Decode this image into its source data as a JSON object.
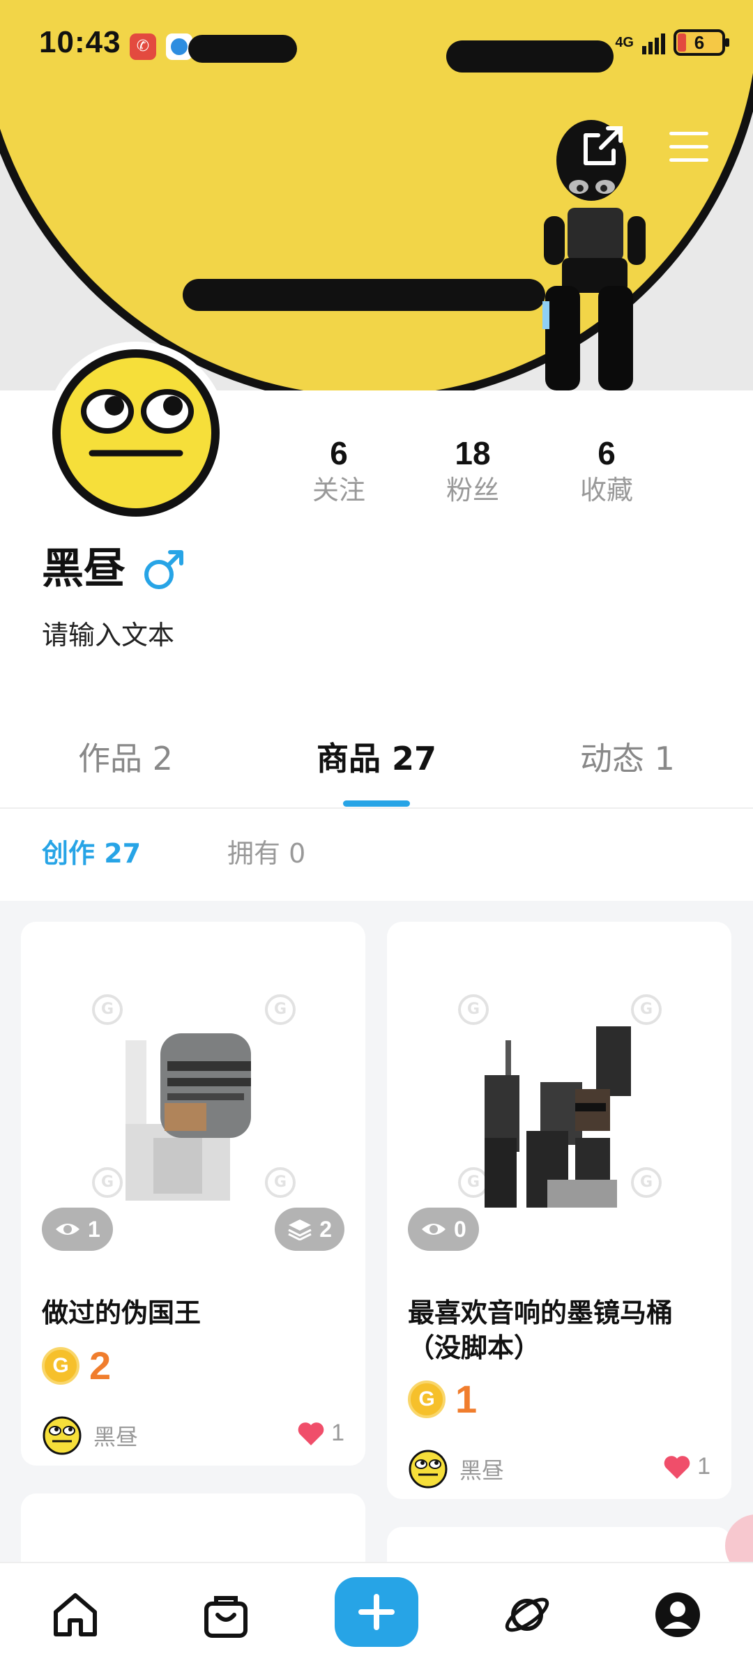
{
  "status_bar": {
    "time": "10:43",
    "network": "4G",
    "battery": "6"
  },
  "profile": {
    "name": "黑昼",
    "gender_icon": "male-icon",
    "bio": "请输入文本",
    "stats": [
      {
        "value": "6",
        "label": "关注"
      },
      {
        "value": "18",
        "label": "粉丝"
      },
      {
        "value": "6",
        "label": "收藏"
      }
    ]
  },
  "main_tabs": [
    {
      "label": "作品 2",
      "active": false
    },
    {
      "label": "商品 27",
      "active": true
    },
    {
      "label": "动态 1",
      "active": false
    }
  ],
  "sub_tabs": [
    {
      "label": "创作 27",
      "active": true
    },
    {
      "label": "拥有 0",
      "active": false
    }
  ],
  "products": [
    {
      "title": "做过的伪国王",
      "views": "1",
      "layers": "2",
      "price": "2",
      "author": "黑昼",
      "likes": "1"
    },
    {
      "title": "最喜欢音响的墨镜马桶（没脚本）",
      "views": "0",
      "price": "1",
      "author": "黑昼",
      "likes": "1"
    }
  ],
  "bottom_nav": [
    {
      "icon": "home-icon"
    },
    {
      "icon": "shop-bag-icon"
    },
    {
      "icon": "plus-icon"
    },
    {
      "icon": "planet-icon"
    },
    {
      "icon": "profile-icon"
    }
  ],
  "colors": {
    "accent": "#27a4e6",
    "price": "#f07d2d",
    "banner": "#f2d548",
    "like": "#f04e6a"
  }
}
